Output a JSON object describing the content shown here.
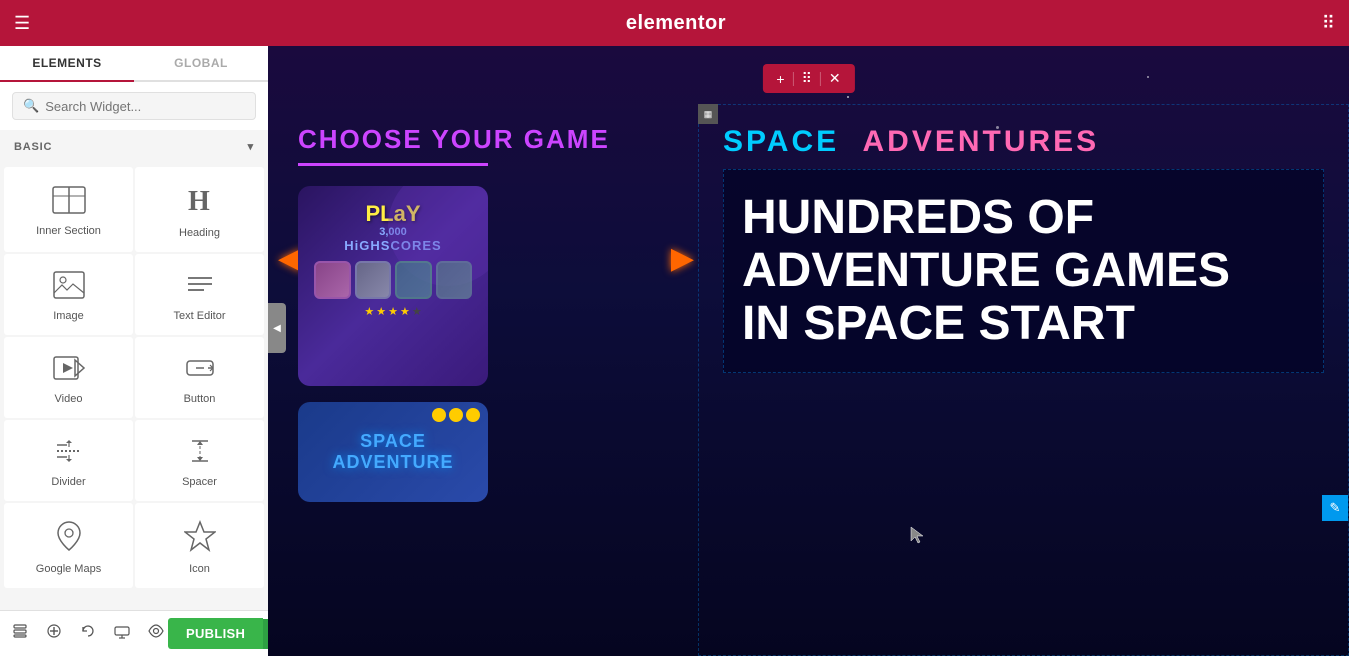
{
  "topbar": {
    "logo": "elementor",
    "menu_icon": "☰",
    "grid_icon": "⋮⋮"
  },
  "sidebar": {
    "tab_elements": "ELEMENTS",
    "tab_global": "GLOBAL",
    "search_placeholder": "Search Widget...",
    "section_label": "BASIC",
    "collapse_icon": "◀",
    "widgets": [
      {
        "id": "inner-section",
        "icon": "inner_section",
        "label": "Inner Section"
      },
      {
        "id": "heading",
        "icon": "heading",
        "label": "Heading"
      },
      {
        "id": "image",
        "icon": "image",
        "label": "Image"
      },
      {
        "id": "text-editor",
        "icon": "text_editor",
        "label": "Text Editor"
      },
      {
        "id": "video",
        "icon": "video",
        "label": "Video"
      },
      {
        "id": "button",
        "icon": "button",
        "label": "Button"
      },
      {
        "id": "divider",
        "icon": "divider",
        "label": "Divider"
      },
      {
        "id": "spacer",
        "icon": "spacer",
        "label": "Spacer"
      },
      {
        "id": "google-maps",
        "icon": "google_maps",
        "label": "Google Maps"
      },
      {
        "id": "icon",
        "icon": "icon",
        "label": "Icon"
      }
    ]
  },
  "bottombar": {
    "icons": [
      "layers",
      "add_section",
      "undo",
      "responsive",
      "hide",
      "history"
    ],
    "publish_label": "PUBLISH",
    "publish_arrow": "▲"
  },
  "section_toolbar": {
    "add": "+",
    "move": "⠿",
    "close": "✕"
  },
  "canvas": {
    "choose_heading": "CHOOSE YOUR GAME",
    "space_title_1": "SPACE",
    "space_title_2": "ADVENTURES",
    "big_heading": "HUNDREDS OF ADVENTURE GAMES IN SPACE START",
    "column_icon": "▦"
  },
  "colors": {
    "toolbar_bg": "#b5153a",
    "sidebar_bg": "#f5f5f5",
    "active_tab_underline": "#b5153a",
    "publish_green": "#39b54a",
    "canvas_bg_top": "#1a0a3e",
    "canvas_bg_bottom": "#050520",
    "choose_color": "#cc44ff",
    "space1_color": "#00ccff",
    "space2_color": "#ff69b4",
    "big_text_color": "#ffffff"
  }
}
